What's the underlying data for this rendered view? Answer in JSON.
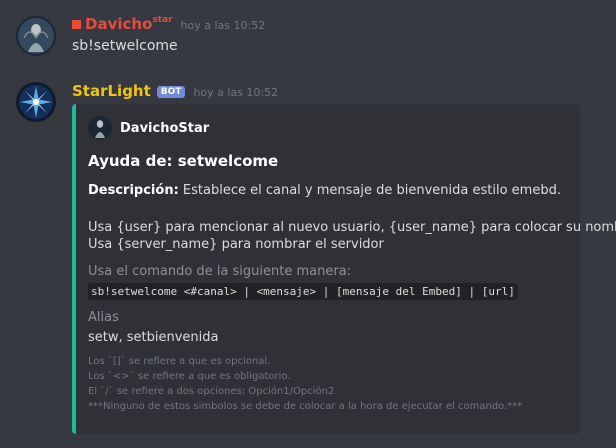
{
  "messages": [
    {
      "username": "Davicho",
      "username_sup": "star",
      "username_color": "#e74c3c",
      "timestamp": "hoy a las 10:52",
      "content": "sb!setwelcome"
    },
    {
      "username": "StarLight",
      "username_color": "#f1c40f",
      "bot_tag": "BOT",
      "timestamp": "hoy a las 10:52",
      "embed": {
        "accent_color": "#1abc9c",
        "author": "DavichoStar",
        "title": "Ayuda de: setwelcome",
        "description_label": "Descripción:",
        "description": " Establece el canal y mensaje de bienvenida estilo emebd.",
        "usage_line_1": "Usa {user} para mencionar al nuevo usuario, {user_name} para colocar su nombre",
        "usage_line_2": "Usa {server_name} para nombrar el servidor",
        "usage_field_name": "Usa el comando de la siguiente manera:",
        "usage_code": "sb!setwelcome <#canal> | <mensaje> | [mensaje del Embed] | [url]",
        "alias_field_name": "Alias",
        "alias_value": "setw, setbienvenida",
        "footer_lines": [
          "Los `[]` se refiere a que es opcional.",
          "Los `<>` se refiere a que es obligatorio.",
          "El `/` se refiere a dos opciones: Opción1/Opción2",
          "***Ninguno de estos simbolos se debe de colocar a la hora de ejecutar el comando.***"
        ]
      }
    }
  ]
}
